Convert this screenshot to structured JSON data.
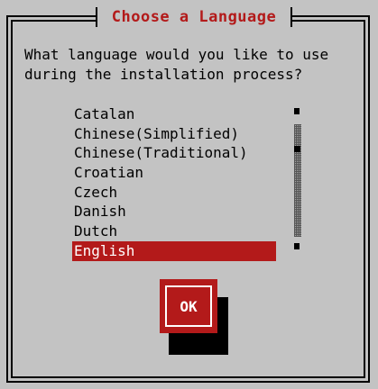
{
  "dialog": {
    "title": "Choose a Language",
    "prompt": "What language would you like to use\nduring the installation process?"
  },
  "languages": {
    "items": [
      {
        "label": "Catalan",
        "selected": false
      },
      {
        "label": "Chinese(Simplified)",
        "selected": false
      },
      {
        "label": "Chinese(Traditional)",
        "selected": false
      },
      {
        "label": "Croatian",
        "selected": false
      },
      {
        "label": "Czech",
        "selected": false
      },
      {
        "label": "Danish",
        "selected": false
      },
      {
        "label": "Dutch",
        "selected": false
      },
      {
        "label": "English",
        "selected": true
      }
    ]
  },
  "buttons": {
    "ok_label": "OK"
  },
  "colors": {
    "background": "#c3c3c3",
    "accent": "#b31a1a",
    "selected_text": "#ffffff"
  }
}
